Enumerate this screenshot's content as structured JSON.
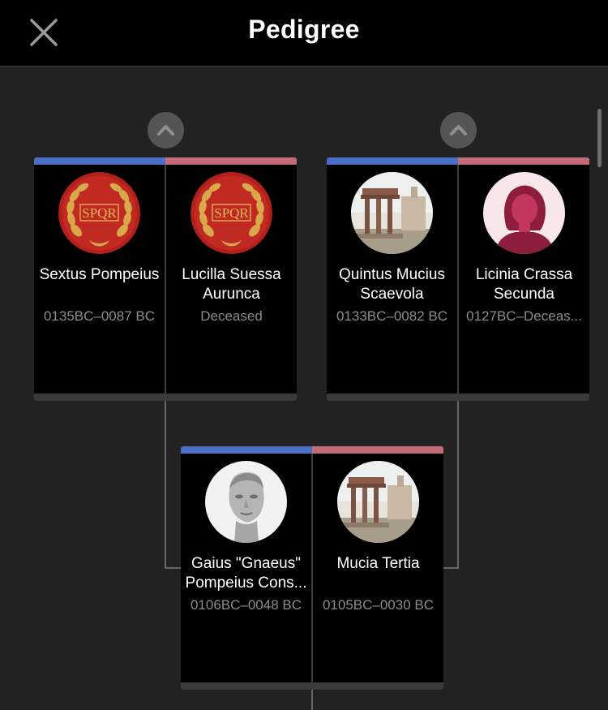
{
  "header": {
    "title": "Pedigree",
    "close_icon": "close-icon"
  },
  "colors": {
    "male_bar": "#4a6fc7",
    "female_bar": "#c46b78",
    "card_bg": "#000000",
    "page_bg": "#222222"
  },
  "expand_icon": "chevron-up-icon",
  "couples": {
    "paternal_grandparents": {
      "father": {
        "name": "Sextus Pompeius",
        "dates": "0135BC–0087 BC",
        "avatar": "spqr-laurel-emblem"
      },
      "mother": {
        "name": "Lucilla Suessa Aurunca",
        "dates": "Deceased",
        "avatar": "spqr-laurel-emblem"
      }
    },
    "maternal_grandparents": {
      "father": {
        "name": "Quintus Mucius Scaevola",
        "dates": "0133BC–0082 BC",
        "avatar": "roman-forum-ruins-painting"
      },
      "mother": {
        "name": "Licinia Crassa Secunda",
        "dates": "0127BC–Deceas...",
        "avatar": "female-silhouette"
      }
    },
    "parents": {
      "father": {
        "name": "Gaius \"Gnaeus\" Pompeius Cons...",
        "dates": "0106BC–0048 BC",
        "avatar": "marble-bust-portrait"
      },
      "mother": {
        "name": "Mucia Tertia",
        "dates": "0105BC–0030 BC",
        "avatar": "roman-forum-ruins-painting"
      }
    }
  }
}
